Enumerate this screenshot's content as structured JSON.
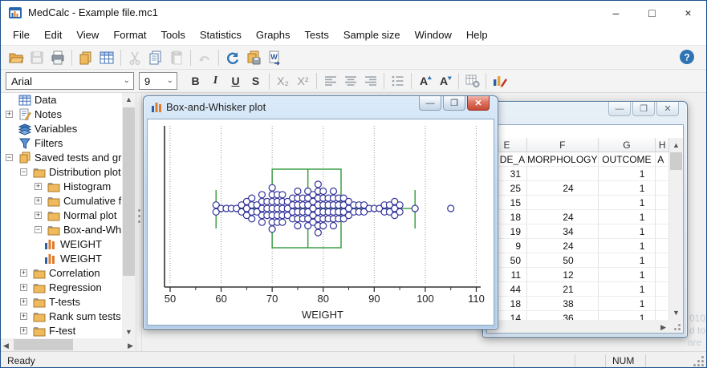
{
  "window": {
    "title": "MedCalc - Example file.mc1"
  },
  "window_controls": {
    "minimize": "–",
    "maximize": "□",
    "close": "×"
  },
  "menu_items": [
    "File",
    "Edit",
    "View",
    "Format",
    "Tools",
    "Statistics",
    "Graphs",
    "Tests",
    "Sample size",
    "Window",
    "Help"
  ],
  "toolbar": {
    "buttons": [
      {
        "name": "open-file",
        "icon": "open",
        "disabled": false,
        "sep_after": false
      },
      {
        "name": "save",
        "icon": "save",
        "disabled": true,
        "sep_after": false
      },
      {
        "name": "print",
        "icon": "print",
        "disabled": false,
        "sep_after": true
      },
      {
        "name": "copy-pages",
        "icon": "copypages",
        "disabled": false,
        "sep_after": false
      },
      {
        "name": "data-grid",
        "icon": "grid",
        "disabled": false,
        "sep_after": true
      },
      {
        "name": "cut",
        "icon": "cut",
        "disabled": true,
        "sep_after": false
      },
      {
        "name": "copy",
        "icon": "copy",
        "disabled": false,
        "sep_after": false
      },
      {
        "name": "paste",
        "icon": "paste",
        "disabled": true,
        "sep_after": true
      },
      {
        "name": "undo",
        "icon": "undo",
        "disabled": true,
        "sep_after": true
      },
      {
        "name": "refresh",
        "icon": "refresh",
        "disabled": false,
        "sep_after": false
      },
      {
        "name": "save-all",
        "icon": "saveall",
        "disabled": false,
        "sep_after": false
      },
      {
        "name": "export-word",
        "icon": "word",
        "disabled": false,
        "sep_after": false
      }
    ]
  },
  "format_toolbar": {
    "font_name": "Arial",
    "font_size": "9",
    "buttons": [
      {
        "name": "bold",
        "label": "B",
        "cls": "fb-b",
        "disabled": false
      },
      {
        "name": "italic",
        "label": "I",
        "cls": "fb-i",
        "disabled": false
      },
      {
        "name": "underline",
        "label": "U",
        "cls": "fb-u",
        "disabled": false
      },
      {
        "name": "strikethrough",
        "label": "S",
        "cls": "fb-s",
        "disabled": false
      },
      {
        "sep": true
      },
      {
        "name": "subscript",
        "label": "X₂",
        "cls": "",
        "disabled": true
      },
      {
        "name": "superscript",
        "label": "X²",
        "cls": "",
        "disabled": true
      },
      {
        "sep": true
      },
      {
        "name": "align-left",
        "glyph": "align-left",
        "disabled": true
      },
      {
        "name": "align-center",
        "glyph": "align-center",
        "disabled": true
      },
      {
        "name": "align-right",
        "glyph": "align-right",
        "disabled": true
      },
      {
        "sep": true
      },
      {
        "name": "list",
        "glyph": "list",
        "disabled": true
      },
      {
        "sep": true
      },
      {
        "name": "increase-font",
        "glyph": "font-up",
        "disabled": false
      },
      {
        "name": "decrease-font",
        "glyph": "font-down",
        "disabled": false
      },
      {
        "sep": true
      },
      {
        "name": "format-table",
        "glyph": "table-gear",
        "disabled": true
      },
      {
        "sep": true
      },
      {
        "name": "edit-graph",
        "glyph": "chart-edit",
        "disabled": false
      }
    ]
  },
  "sidebar": {
    "items": [
      {
        "label": "Data",
        "icon": "table",
        "level": 0,
        "expander": ""
      },
      {
        "label": "Notes",
        "icon": "notes",
        "level": 0,
        "expander": "+"
      },
      {
        "label": "Variables",
        "icon": "layers",
        "level": 0,
        "expander": ""
      },
      {
        "label": "Filters",
        "icon": "filter",
        "level": 0,
        "expander": ""
      },
      {
        "label": "Saved tests and grap",
        "icon": "pages",
        "level": 0,
        "expander": "-"
      },
      {
        "label": "Distribution plot",
        "icon": "folder",
        "level": 1,
        "expander": "-"
      },
      {
        "label": "Histogram",
        "icon": "folder",
        "level": 2,
        "expander": "+"
      },
      {
        "label": "Cumulative fr",
        "icon": "folder",
        "level": 2,
        "expander": "+"
      },
      {
        "label": "Normal plot",
        "icon": "folder",
        "level": 2,
        "expander": "+"
      },
      {
        "label": "Box-and-Whi",
        "icon": "folder",
        "level": 2,
        "expander": "-"
      },
      {
        "label": "WEIGHT",
        "icon": "chart",
        "level": 3,
        "expander": ""
      },
      {
        "label": "WEIGHT",
        "icon": "chart",
        "level": 3,
        "expander": ""
      },
      {
        "label": "Correlation",
        "icon": "folder",
        "level": 1,
        "expander": "+"
      },
      {
        "label": "Regression",
        "icon": "folder",
        "level": 1,
        "expander": "+"
      },
      {
        "label": "T-tests",
        "icon": "folder",
        "level": 1,
        "expander": "+"
      },
      {
        "label": "Rank sum tests",
        "icon": "folder",
        "level": 1,
        "expander": "+"
      },
      {
        "label": "F-test",
        "icon": "folder",
        "level": 1,
        "expander": "+"
      }
    ]
  },
  "plot_window": {
    "title": "Box-and-Whisker plot"
  },
  "chart_data": {
    "type": "boxplot",
    "orientation": "horizontal",
    "title": "",
    "xlabel": "WEIGHT",
    "xlim": [
      50,
      110
    ],
    "xticks": [
      50,
      60,
      70,
      80,
      90,
      100,
      110
    ],
    "grid": "dotted-vertical",
    "box": {
      "whisker_low": 59,
      "q1": 70,
      "median": 77,
      "q3": 83.5,
      "whisker_high": 98
    },
    "outliers": [
      105
    ],
    "points": [
      {
        "x": 59,
        "n": 2
      },
      {
        "x": 60,
        "n": 1
      },
      {
        "x": 61,
        "n": 1
      },
      {
        "x": 62,
        "n": 1
      },
      {
        "x": 63,
        "n": 1
      },
      {
        "x": 64,
        "n": 2
      },
      {
        "x": 65,
        "n": 3
      },
      {
        "x": 66,
        "n": 4
      },
      {
        "x": 67,
        "n": 2
      },
      {
        "x": 68,
        "n": 5
      },
      {
        "x": 69,
        "n": 3
      },
      {
        "x": 70,
        "n": 7
      },
      {
        "x": 71,
        "n": 5
      },
      {
        "x": 72,
        "n": 5
      },
      {
        "x": 73,
        "n": 3
      },
      {
        "x": 74,
        "n": 4
      },
      {
        "x": 75,
        "n": 6
      },
      {
        "x": 76,
        "n": 4
      },
      {
        "x": 77,
        "n": 6
      },
      {
        "x": 78,
        "n": 5
      },
      {
        "x": 79,
        "n": 8
      },
      {
        "x": 80,
        "n": 6
      },
      {
        "x": 81,
        "n": 4
      },
      {
        "x": 82,
        "n": 6
      },
      {
        "x": 83,
        "n": 4
      },
      {
        "x": 84,
        "n": 4
      },
      {
        "x": 85,
        "n": 3
      },
      {
        "x": 86,
        "n": 2
      },
      {
        "x": 87,
        "n": 2
      },
      {
        "x": 88,
        "n": 2
      },
      {
        "x": 89,
        "n": 1
      },
      {
        "x": 90,
        "n": 1
      },
      {
        "x": 91,
        "n": 1
      },
      {
        "x": 92,
        "n": 2
      },
      {
        "x": 93,
        "n": 2
      },
      {
        "x": 94,
        "n": 3
      },
      {
        "x": 95,
        "n": 2
      },
      {
        "x": 98,
        "n": 1
      }
    ],
    "colors": {
      "box": "#3f9f46",
      "dot": "#32329a",
      "axis": "#333333",
      "gridline": "#9a9a9a"
    }
  },
  "grid_window": {
    "columns": [
      "E",
      "F",
      "G",
      "H"
    ],
    "variable_row": [
      "DE_A",
      "MORPHOLOGY",
      "OUTCOME",
      "A"
    ],
    "rows": [
      [
        "31",
        "",
        "1",
        ""
      ],
      [
        "25",
        "24",
        "1",
        ""
      ],
      [
        "15",
        "",
        "1",
        ""
      ],
      [
        "18",
        "24",
        "1",
        ""
      ],
      [
        "19",
        "34",
        "1",
        ""
      ],
      [
        "9",
        "24",
        "1",
        ""
      ],
      [
        "50",
        "50",
        "1",
        ""
      ],
      [
        "11",
        "12",
        "1",
        ""
      ],
      [
        "44",
        "21",
        "1",
        ""
      ],
      [
        "18",
        "38",
        "1",
        ""
      ],
      [
        "14",
        "36",
        "1",
        ""
      ]
    ]
  },
  "watermark_lines": [
    "010",
    "d to",
    "are"
  ],
  "status_bar": {
    "ready": "Ready",
    "num": "NUM"
  },
  "colors": {
    "accent_blue": "#2e74b5",
    "folder_orange": "#efb95e",
    "aero_titlebar": "#bcd5ee"
  }
}
